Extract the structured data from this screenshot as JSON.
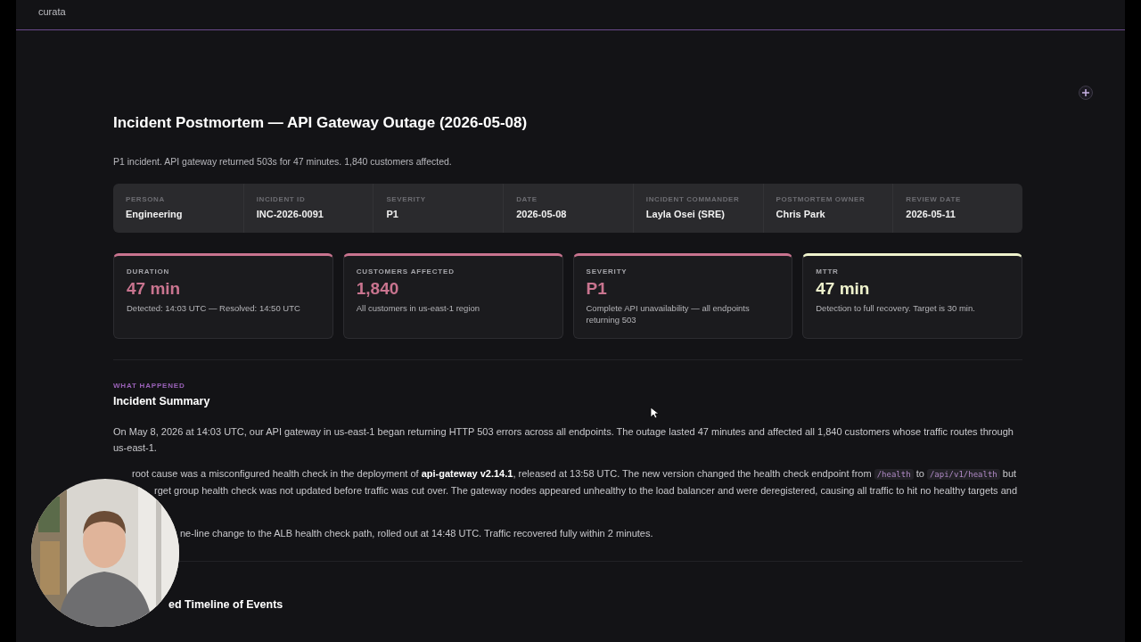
{
  "app": {
    "brand": "curata"
  },
  "page": {
    "title": "Incident Postmortem — API Gateway Outage (2026-05-08)",
    "subtitle": "P1 incident. API gateway returned 503s for 47 minutes. 1,840 customers affected."
  },
  "meta": [
    {
      "label": "PERSONA",
      "value": "Engineering"
    },
    {
      "label": "INCIDENT ID",
      "value": "INC-2026-0091"
    },
    {
      "label": "SEVERITY",
      "value": "P1"
    },
    {
      "label": "DATE",
      "value": "2026-05-08"
    },
    {
      "label": "INCIDENT COMMANDER",
      "value": "Layla Osei (SRE)"
    },
    {
      "label": "POSTMORTEM OWNER",
      "value": "Chris Park"
    },
    {
      "label": "REVIEW DATE",
      "value": "2026-05-11"
    }
  ],
  "stats": [
    {
      "label": "DURATION",
      "value": "47 min",
      "note": "Detected: 14:03 UTC — Resolved: 14:50 UTC",
      "color": "#c9748f"
    },
    {
      "label": "CUSTOMERS AFFECTED",
      "value": "1,840",
      "note": "All customers in us-east-1 region",
      "color": "#c9748f"
    },
    {
      "label": "SEVERITY",
      "value": "P1",
      "note": "Complete API unavailability — all endpoints returning 503",
      "color": "#c9748f"
    },
    {
      "label": "MTTR",
      "value": "47 min",
      "note": "Detection to full recovery. Target is 30 min.",
      "color": "#eef2cc"
    }
  ],
  "summary": {
    "eyebrow": "WHAT HAPPENED",
    "heading": "Incident Summary",
    "intro": "On May 8, 2026 at 14:03 UTC, our API gateway in us-east-1 began returning HTTP 503 errors across all endpoints. The outage lasted 47 minutes and affected all 1,840 customers whose traffic routes through us-east-1.",
    "lines": [
      [
        {
          "kind": "plain",
          "text": "root cause was a misconfigured health check in the deployment of "
        },
        {
          "kind": "bold",
          "text": "api-gateway v2.14.1"
        },
        {
          "kind": "plain",
          "text": ", released at 13:58 UTC. The new version changed the health check endpoint from "
        },
        {
          "kind": "code",
          "text": "/health"
        },
        {
          "kind": "plain",
          "text": " to "
        },
        {
          "kind": "code",
          "text": "/api/v1/health"
        },
        {
          "kind": "plain",
          "text": " but"
        }
      ],
      [
        {
          "kind": "plain",
          "text": "rget group health check was not updated before traffic was cut over. The gateway nodes appeared unhealthy to the load balancer and were deregistered, causing all traffic to hit no healthy targets and"
        }
      ],
      [
        {
          "kind": "plain",
          "text": "ne-line change to the ALB health check path, rolled out at 14:48 UTC. Traffic recovered fully within 2 minutes."
        }
      ]
    ]
  },
  "next_heading": "ed Timeline of Events"
}
